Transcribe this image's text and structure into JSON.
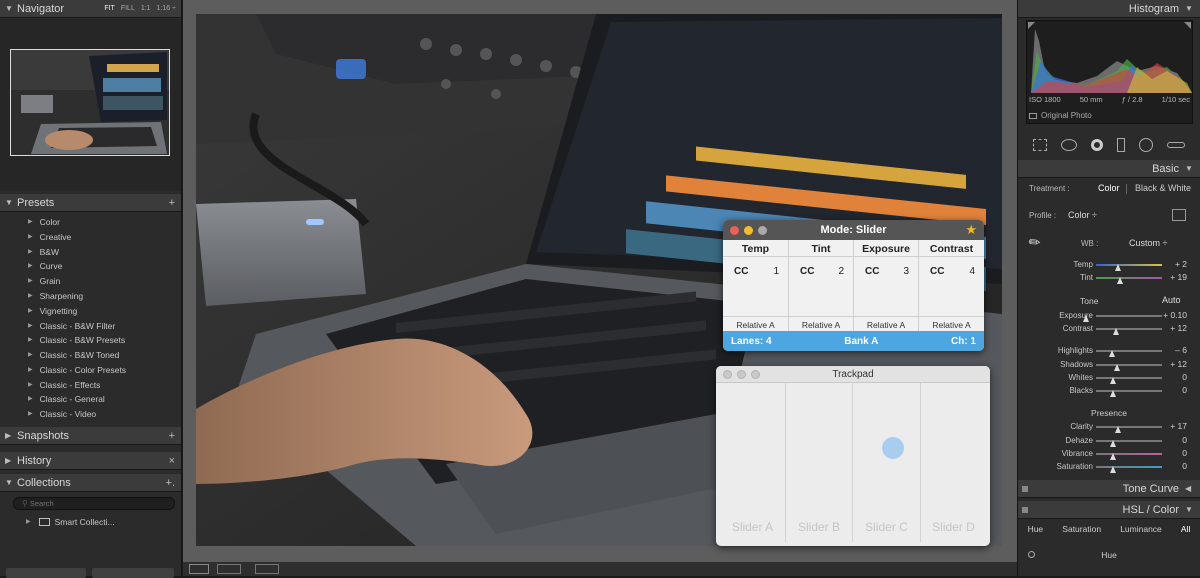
{
  "navigator": {
    "title": "Navigator",
    "zoom_opts": [
      "FIT",
      "FILL",
      "1:1",
      "1:16 ÷"
    ]
  },
  "presets": {
    "title": "Presets",
    "add": "+",
    "items": [
      "Color",
      "Creative",
      "B&W",
      "Curve",
      "Grain",
      "Sharpening",
      "Vignetting",
      "Classic - B&W Filter",
      "Classic - B&W Presets",
      "Classic - B&W Toned",
      "Classic - Color Presets",
      "Classic - Effects",
      "Classic - General",
      "Classic - Video"
    ]
  },
  "snapshots": {
    "title": "Snapshots",
    "add": "+"
  },
  "history": {
    "title": "History",
    "close": "×"
  },
  "collections": {
    "title": "Collections",
    "add": "+.",
    "search_placeholder": "Search",
    "smart": "Smart Collecti..."
  },
  "histogram": {
    "title": "Histogram",
    "iso": "ISO 1800",
    "focal": "50 mm",
    "aperture": "ƒ / 2.8",
    "shutter": "1/10 sec",
    "original": "Original Photo"
  },
  "basic": {
    "title": "Basic",
    "treatment_label": "Treatment :",
    "treatment_color": "Color",
    "treatment_bw": "Black & White",
    "profile_label": "Profile :",
    "profile_value": "Color ÷",
    "wb_label": "WB :",
    "wb_value": "Custom ÷",
    "temp_label": "Temp",
    "temp_value": "+ 2",
    "tint_label": "Tint",
    "tint_value": "+ 19",
    "tone_label": "Tone",
    "auto_label": "Auto",
    "exposure_label": "Exposure",
    "exposure_value": "+ 0.10",
    "contrast_label": "Contrast",
    "contrast_value": "+ 12",
    "highlights_label": "Highlights",
    "highlights_value": "– 6",
    "shadows_label": "Shadows",
    "shadows_value": "+ 12",
    "whites_label": "Whites",
    "whites_value": "0",
    "blacks_label": "Blacks",
    "blacks_value": "0",
    "presence_label": "Presence",
    "clarity_label": "Clarity",
    "clarity_value": "+ 17",
    "dehaze_label": "Dehaze",
    "dehaze_value": "0",
    "vibrance_label": "Vibrance",
    "vibrance_value": "0",
    "saturation_label": "Saturation",
    "saturation_value": "0"
  },
  "tone_curve": {
    "title": "Tone Curve"
  },
  "hsl": {
    "title": "HSL / Color",
    "tabs": [
      "Hue",
      "Saturation",
      "Luminance",
      "All"
    ],
    "sub": "Hue"
  },
  "mode_window": {
    "title": "Mode: Slider",
    "columns": [
      "Temp",
      "Tint",
      "Exposure",
      "Contrast"
    ],
    "cc_label": "CC",
    "cc_numbers": [
      "1",
      "2",
      "3",
      "4"
    ],
    "relative": [
      "Relative A",
      "Relative A",
      "Relative A",
      "Relative A"
    ],
    "lanes": "Lanes: 4",
    "bank": "Bank A",
    "ch": "Ch: 1"
  },
  "trackpad": {
    "title": "Trackpad",
    "sliders": [
      "Slider A",
      "Slider B",
      "Slider C",
      "Slider D"
    ],
    "touch_slider_index": 2,
    "touch_level": 0.54
  },
  "colors": {
    "accent": "#4da6e0",
    "panel": "#2b2b2b",
    "header": "#3b3b3b"
  }
}
